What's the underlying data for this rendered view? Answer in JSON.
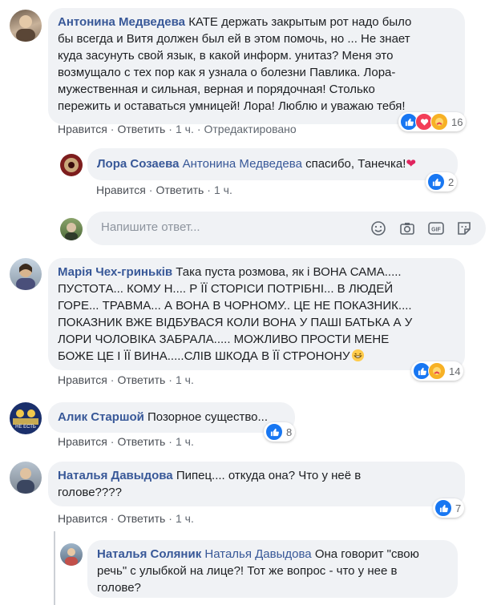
{
  "comments": [
    {
      "author": "Антонина Медведева",
      "lines": [
        "КАТЕ держать закрытым рот надо было",
        "бы всегда и Витя должен был ей в этом помочь, но ... Не знает",
        "куда засунуть свой язык, в какой информ. унитаз? Меня это",
        "возмущало с тех пор как я узнала о болезни Павлика. Лора-",
        "мужественная и сильная, верная и порядочная! Столько",
        "пережить и оставаться умницей! Лора! Люблю и уважаю тебя!"
      ],
      "like": "Нравится",
      "reply": "Ответить",
      "time": "1 ч.",
      "edited": "Отредактировано",
      "reactions_count": "16"
    },
    {
      "author": "Лора Созаева",
      "mention": "Антонина Медведева",
      "text": "спасибо, Танечка!",
      "like": "Нравится",
      "reply": "Ответить",
      "time": "1 ч.",
      "reactions_count": "2"
    },
    {
      "author": "Марія Чех-гринькiв",
      "lines": [
        "Така пуста розмова, як і ВОНА САМА.....",
        "ПУСТОТА... КОМУ Н.... Р ЇЇ СТОРІСИ ПОТРІБНІ... В ЛЮДЕЙ",
        "ГОРЕ... ТРАВМА... А ВОНА В ЧОРНОМУ.. ЦЕ НЕ ПОКАЗНИК....",
        "ПОКАЗНИК ВЖЕ ВІДБУВАСЯ КОЛИ ВОНА У ПАШІ БАТЬКА А У",
        "ЛОРИ ЧОЛОВІКА ЗАБРАЛА..... МОЖЛИВО ПРОСТИ МЕНЕ",
        "БОЖЕ ЦЕ І ЇЇ ВИНА.....СЛІВ ШКОДА В ЇЇ СТРОНОНУ"
      ],
      "like": "Нравится",
      "reply": "Ответить",
      "time": "1 ч.",
      "reactions_count": "14"
    },
    {
      "author": "Алик Старшой",
      "text": "Позорное существо...",
      "like": "Нравится",
      "reply": "Ответить",
      "time": "1 ч.",
      "reactions_count": "8",
      "avatar_caption": "НЕ ЕСТЬ"
    },
    {
      "author": "Наталья Давыдова",
      "lines": [
        "Пипец.... откуда она? Что у неё в",
        "голове????"
      ],
      "like": "Нравится",
      "reply": "Ответить",
      "time": "1 ч.",
      "reactions_count": "7"
    },
    {
      "author": "Наталья Соляник",
      "mention": "Наталья Давыдова",
      "lines": [
        "Она говорит \"свою",
        "речь\" с улыбкой на лице?! Тот же вопрос - что у нее в",
        "голове?"
      ]
    }
  ],
  "reply_input": {
    "placeholder": "Напишите ответ..."
  },
  "separator": "·",
  "icons": [
    "like-icon",
    "love-icon",
    "care-icon",
    "emoji-icon",
    "camera-icon",
    "gif-icon",
    "sticker-icon"
  ],
  "colors": {
    "link": "#385898",
    "bubble": "#f0f2f5",
    "like": "#1877f2",
    "love": "#f33e58",
    "care": "#f7b125"
  }
}
